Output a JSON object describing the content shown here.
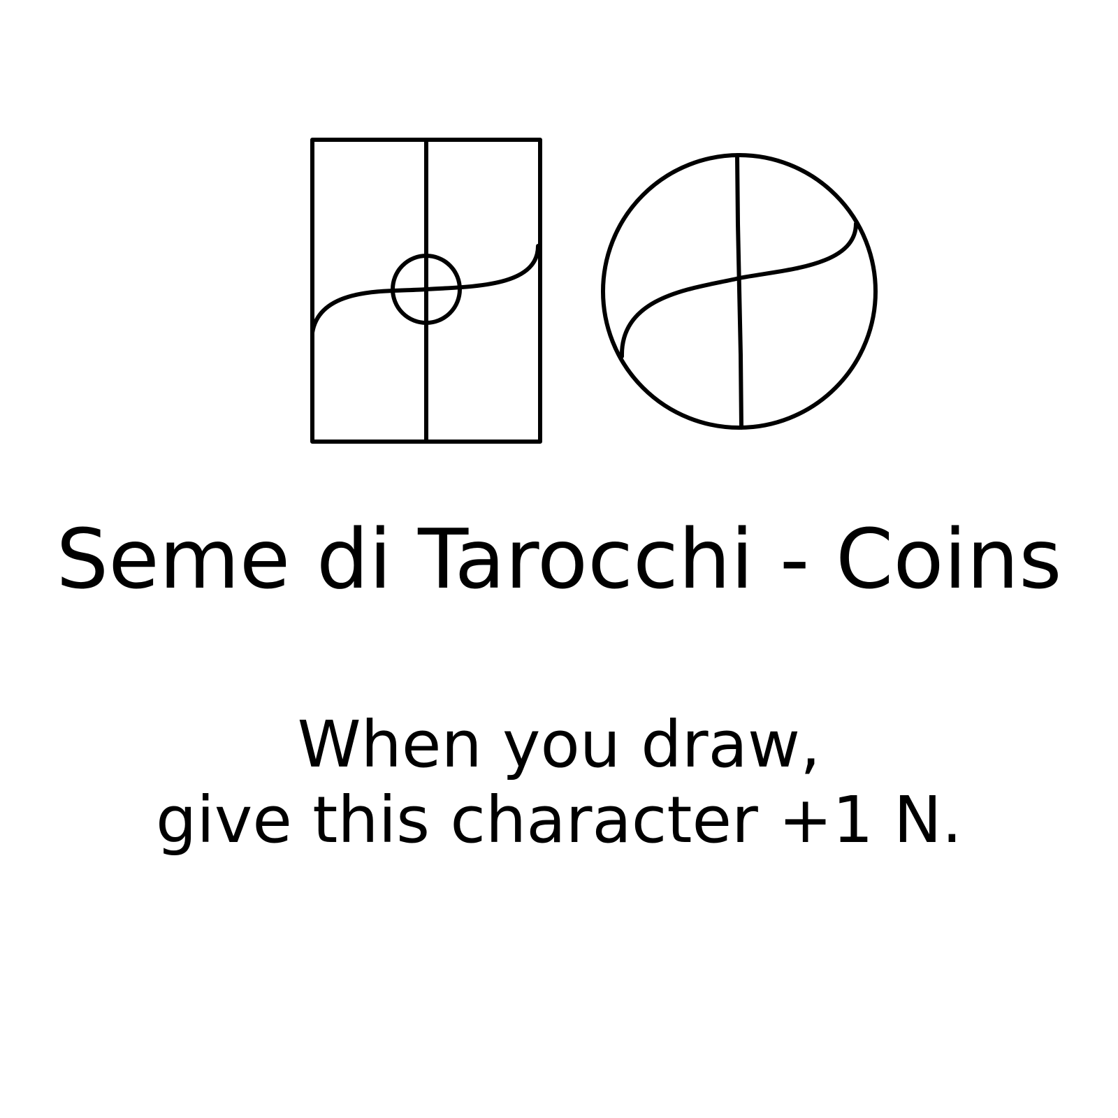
{
  "card": {
    "title": "Seme di Tarocchi - Coins",
    "description_lines": [
      "When you draw,",
      "give this character +1 N."
    ],
    "symbols": [
      {
        "icon": "card-rectangle-glyph-icon"
      },
      {
        "icon": "coin-circle-glyph-icon"
      }
    ],
    "ink_color": "#000000",
    "background_color": "#ffffff"
  }
}
